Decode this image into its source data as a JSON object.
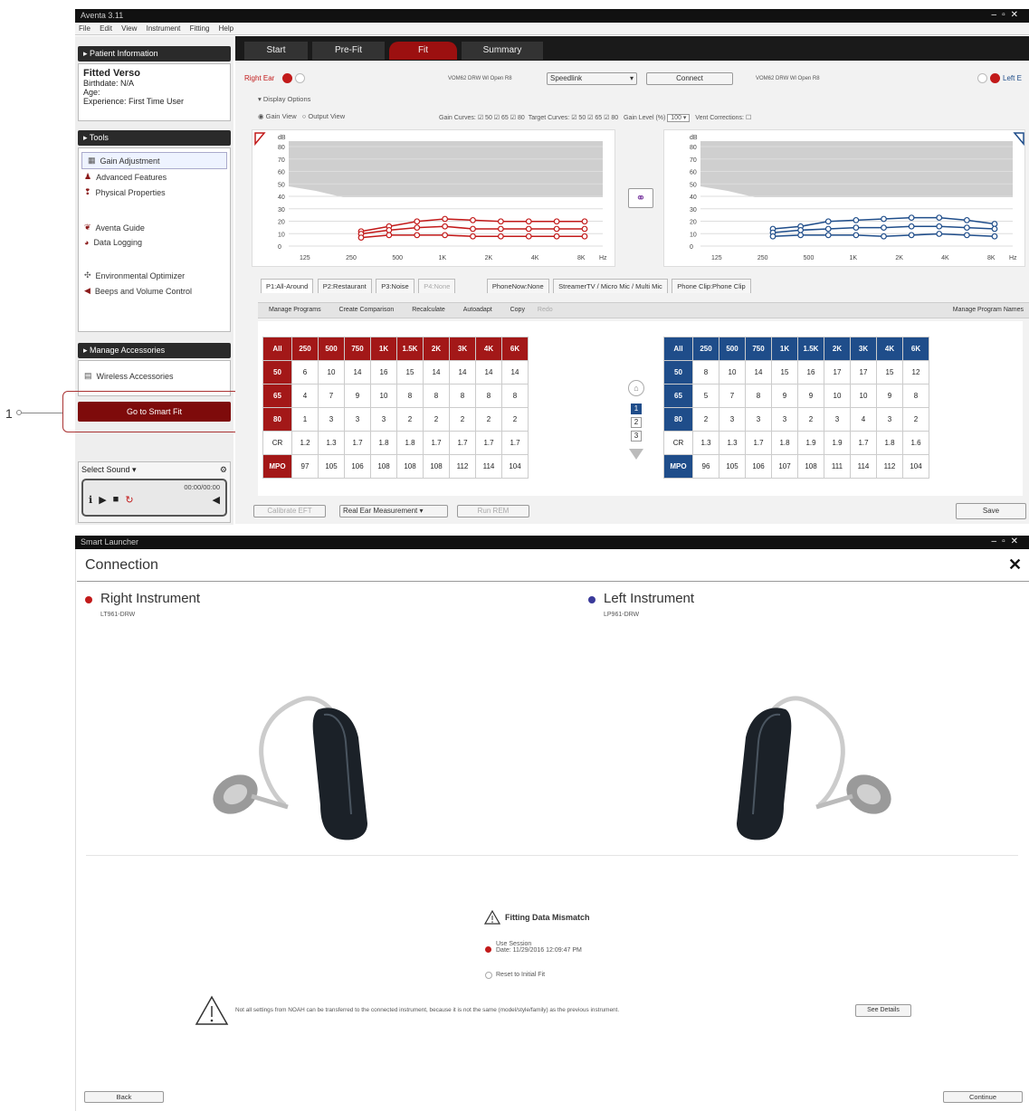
{
  "callout": {
    "number": "1"
  },
  "top": {
    "title": "Aventa 3.11",
    "window_controls": [
      "–",
      "▫",
      "✕"
    ],
    "menu": [
      "File",
      "Edit",
      "View",
      "Instrument",
      "Fitting",
      "Help"
    ],
    "sidebar": {
      "patient_header": "Patient Information",
      "patient_name": "Fitted Verso",
      "birthdate": "Birthdate: N/A",
      "age": "Age:",
      "experience": "Experience: First Time User",
      "tools_header": "Tools",
      "tools": [
        {
          "label": "Gain Adjustment",
          "icon": "gain-icon"
        },
        {
          "label": "Advanced Features",
          "icon": "features-icon"
        },
        {
          "label": "Physical Properties",
          "icon": "properties-icon"
        },
        {
          "label": "Aventa Guide",
          "icon": "guide-icon"
        },
        {
          "label": "Data Logging",
          "icon": "logging-icon"
        },
        {
          "label": "Environmental Optimizer",
          "icon": "optimizer-icon"
        },
        {
          "label": "Beeps and Volume Control",
          "icon": "volume-icon"
        }
      ],
      "accessories_header": "Manage Accessories",
      "wireless": "Wireless Accessories",
      "smart_fit_button": "Go to Smart Fit",
      "select_sound": "Select Sound",
      "time": "00:00/00:00"
    },
    "tabs": [
      "Start",
      "Pre-Fit",
      "Fit",
      "Summary"
    ],
    "right_ear": "Right Ear",
    "left_ear": "Left E",
    "speedlink": "Speedlink",
    "connect": "Connect",
    "device_right": "VOM62 DRW Wl Open R8",
    "device_left": "VOM62 DRW Wl Open R8",
    "display_options": "Display Options",
    "gain_view": "Gain View",
    "output_view": "Output View",
    "gain_curves": "Gain Curves:",
    "target_curves": "Target Curves:",
    "curve_levels": [
      "50",
      "65",
      "80"
    ],
    "gain_level": "Gain Level (%)",
    "gain_level_value": "100",
    "vent_corrections": "Vent Corrections:",
    "chart_y_label": "dB",
    "chart_y_ticks": [
      "80",
      "70",
      "60",
      "50",
      "40",
      "30",
      "20",
      "10",
      "0"
    ],
    "chart_x_ticks": [
      "125",
      "250",
      "500",
      "1K",
      "2K",
      "4K",
      "8K"
    ],
    "chart_x_unit": "Hz",
    "program_tabs": [
      "P1:All-Around",
      "P2:Restaurant",
      "P3:Noise",
      "P4:None",
      "PhoneNow:None",
      "StreamerTV / Micro Mic / Multi Mic",
      "Phone Clip:Phone Clip"
    ],
    "actions": [
      "Manage Programs",
      "Create Comparison",
      "Recalculate",
      "Autoadapt",
      "Copy",
      "Redo"
    ],
    "manage_names": "Manage Program Names",
    "grid_cols": [
      "All",
      "250",
      "500",
      "750",
      "1K",
      "1.5K",
      "2K",
      "3K",
      "4K",
      "6K"
    ],
    "right_grid": [
      [
        "50",
        "6",
        "10",
        "14",
        "16",
        "15",
        "14",
        "14",
        "14",
        "14"
      ],
      [
        "65",
        "4",
        "7",
        "9",
        "10",
        "8",
        "8",
        "8",
        "8",
        "8"
      ],
      [
        "80",
        "1",
        "3",
        "3",
        "3",
        "2",
        "2",
        "2",
        "2",
        "2"
      ],
      [
        "CR",
        "1.2",
        "1.3",
        "1.7",
        "1.8",
        "1.8",
        "1.7",
        "1.7",
        "1.7",
        "1.7"
      ],
      [
        "MPO",
        "97",
        "105",
        "106",
        "108",
        "108",
        "108",
        "112",
        "114",
        "104"
      ]
    ],
    "left_grid": [
      [
        "50",
        "8",
        "10",
        "14",
        "15",
        "16",
        "17",
        "17",
        "15",
        "12"
      ],
      [
        "65",
        "5",
        "7",
        "8",
        "9",
        "9",
        "10",
        "10",
        "9",
        "8"
      ],
      [
        "80",
        "2",
        "3",
        "3",
        "3",
        "2",
        "3",
        "4",
        "3",
        "2"
      ],
      [
        "CR",
        "1.3",
        "1.3",
        "1.7",
        "1.8",
        "1.9",
        "1.9",
        "1.7",
        "1.8",
        "1.6"
      ],
      [
        "MPO",
        "96",
        "105",
        "106",
        "107",
        "108",
        "111",
        "114",
        "112",
        "104"
      ]
    ],
    "nav_numbers": [
      "1",
      "2",
      "3"
    ],
    "calibrate": "Calibrate EFT",
    "rem": "Real Ear Measurement",
    "run_rem": "Run REM",
    "save": "Save"
  },
  "bottom": {
    "title": "Smart Launcher",
    "heading": "Connection",
    "close": "✕",
    "right_label": "Right Instrument",
    "right_model": "LT961-DRW",
    "left_label": "Left Instrument",
    "left_model": "LP961-DRW",
    "mismatch_title": "Fitting Data Mismatch",
    "use_session": "Use Session",
    "session_date": "Date: 11/29/2016 12:09:47 PM",
    "reset": "Reset to Initial Fit",
    "warning": "Not all settings from NOAH can be transferred to the connected instrument, because it is not the same (model/style/family) as the previous instrument.",
    "see_details": "See Details",
    "back": "Back",
    "continue": "Continue"
  },
  "colors": {
    "right": "#c21a1a",
    "left": "#1f4d8a",
    "accent": "#8b0d0d"
  }
}
